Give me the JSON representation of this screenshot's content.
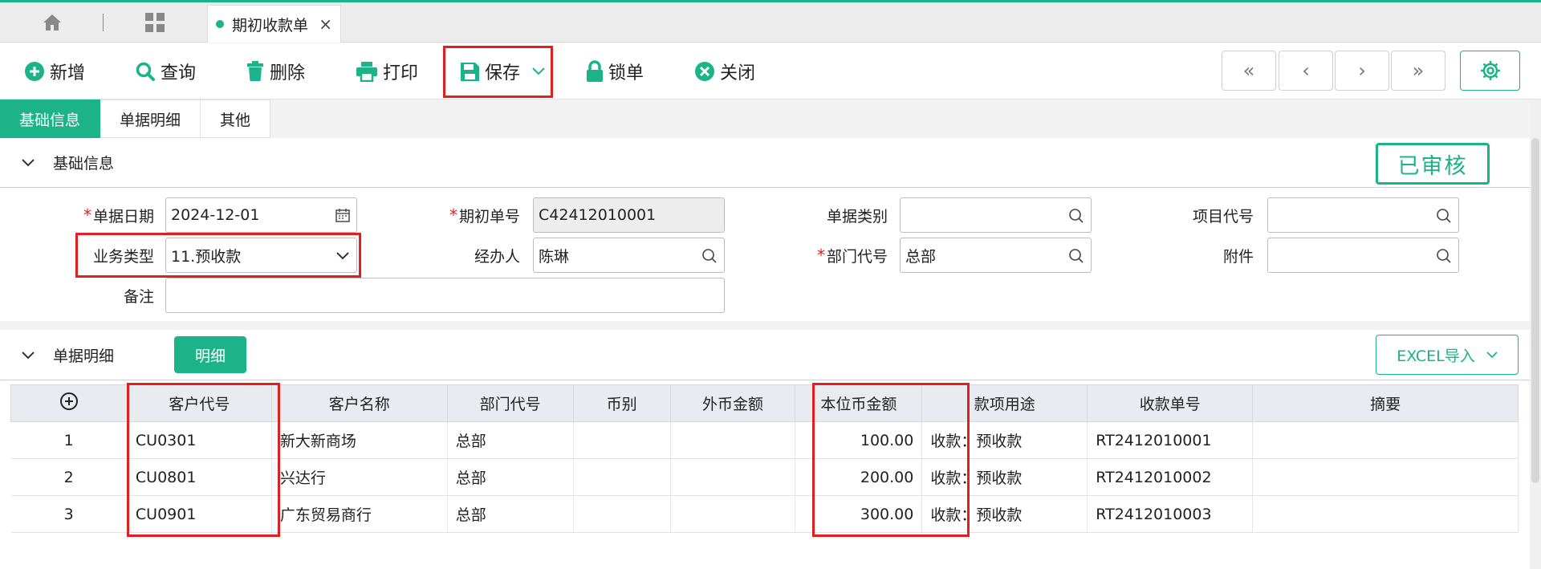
{
  "tabbar": {
    "tab_title": "期初收款单",
    "close_glyph": "×"
  },
  "toolbar": {
    "add": "新增",
    "query": "查询",
    "delete": "删除",
    "print": "打印",
    "save": "保存",
    "lock": "锁单",
    "close": "关闭",
    "nav": {
      "first": "«",
      "prev": "‹",
      "next": "›",
      "last": "»"
    }
  },
  "subtabs": [
    "基础信息",
    "单据明细",
    "其他"
  ],
  "basic": {
    "section_title": "基础信息",
    "status": "已审核",
    "fields": {
      "date_label": "单据日期",
      "date_value": "2024-12-01",
      "biz_type_label": "业务类型",
      "biz_type_value": "11.预收款",
      "remark_label": "备注",
      "remark_value": "",
      "no_label": "期初单号",
      "no_value": "C42412010001",
      "handler_label": "经办人",
      "handler_value": "陈琳",
      "category_label": "单据类别",
      "category_value": "",
      "dept_label": "部门代号",
      "dept_value": "总部",
      "project_label": "项目代号",
      "project_value": "",
      "attach_label": "附件",
      "attach_value": ""
    }
  },
  "detail": {
    "section_title": "单据明细",
    "detail_button": "明细",
    "excel_button": "EXCEL导入",
    "columns": [
      "客户代号",
      "客户名称",
      "部门代号",
      "币别",
      "外币金额",
      "本位币金额",
      "款项用途",
      "收款单号",
      "摘要"
    ],
    "rows": [
      {
        "no": "1",
        "cust_code": "CU0301",
        "cust_name": "新大新商场",
        "dept": "总部",
        "currency": "",
        "fx_amount": "",
        "amount": "100.00",
        "purpose": "收款：预收款",
        "receipt_no": "RT2412010001",
        "memo": ""
      },
      {
        "no": "2",
        "cust_code": "CU0801",
        "cust_name": "兴达行",
        "dept": "总部",
        "currency": "",
        "fx_amount": "",
        "amount": "200.00",
        "purpose": "收款：预收款",
        "receipt_no": "RT2412010002",
        "memo": ""
      },
      {
        "no": "3",
        "cust_code": "CU0901",
        "cust_name": "广东贸易商行",
        "dept": "总部",
        "currency": "",
        "fx_amount": "",
        "amount": "300.00",
        "purpose": "收款：预收款",
        "receipt_no": "RT2412010003",
        "memo": ""
      }
    ]
  },
  "colors": {
    "accent": "#1bb387",
    "highlight": "#e02020"
  }
}
